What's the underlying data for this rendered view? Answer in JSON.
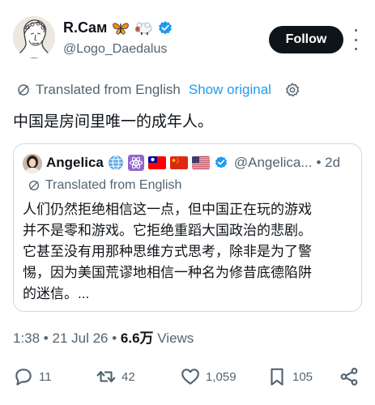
{
  "author": {
    "display_name": "R.Cам",
    "badge_emojis": [
      "butterfly-emoji",
      "sheep-emoji"
    ],
    "handle": "@Logo_Daedalus",
    "follow_label": "Follow"
  },
  "translation": {
    "label": "Translated from English",
    "show_original": "Show original"
  },
  "tweet": {
    "text": "中国是房间里唯一的成年人。"
  },
  "quote": {
    "name": "Angelica",
    "emoji_icons": [
      "globe-icon",
      "atom-icon",
      "taiwan-flag",
      "china-flag",
      "usa-flag"
    ],
    "handle": "@Angelica...",
    "time": "• 2d",
    "translated_label": "Translated from English",
    "lines": [
      "人们仍然拒绝相信这一点，但中国正在玩的游戏",
      "并不是零和游戏。它拒绝重蹈大国政治的悲剧。",
      "它甚至没有用那种思维方式思考，除非是为了警",
      "惕，因为美国荒谬地相信一种名为修昔底德陷阱",
      "的迷信。..."
    ]
  },
  "meta": {
    "time": "1:38 • 21 Jul 26 • ",
    "views_count": "6.6万",
    "views_label": " Views"
  },
  "actions": {
    "replies": "11",
    "reposts": "42",
    "likes": "1,059",
    "bookmarks": "105"
  },
  "colors": {
    "accent": "#1d9bf0",
    "text": "#0f1419",
    "secondary": "#536471",
    "border": "#cfd9de"
  }
}
